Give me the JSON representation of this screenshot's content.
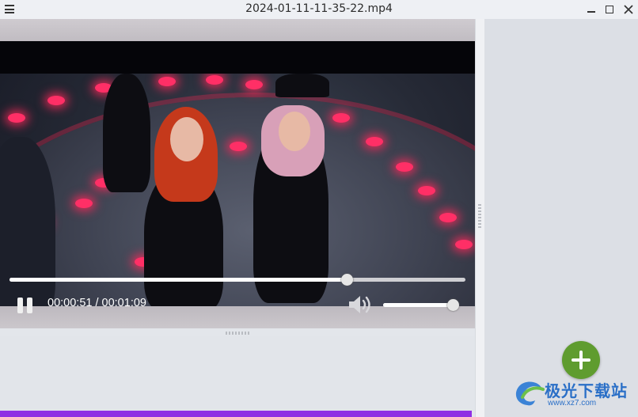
{
  "window": {
    "title": "2024-01-11-11-35-22.mp4",
    "menu_icon": "hamburger-icon",
    "controls": [
      "minimize-icon",
      "maximize-icon",
      "close-icon"
    ]
  },
  "player": {
    "current_time": "00:00:51",
    "duration": "00:01:09",
    "time_display": "00:00:51 / 00:01:09",
    "progress_fraction": 0.739,
    "volume_fraction": 1.0,
    "state": "playing",
    "pause_icon": "pause-icon",
    "volume_icon": "speaker-icon"
  },
  "right_panel": {
    "add_icon": "plus-icon",
    "accent_color": "#5f9c2f"
  },
  "colors": {
    "bottom_bar": "#8f2fe3"
  },
  "watermark": {
    "logo_text": "极光下载站",
    "url": "www.xz7.com"
  }
}
